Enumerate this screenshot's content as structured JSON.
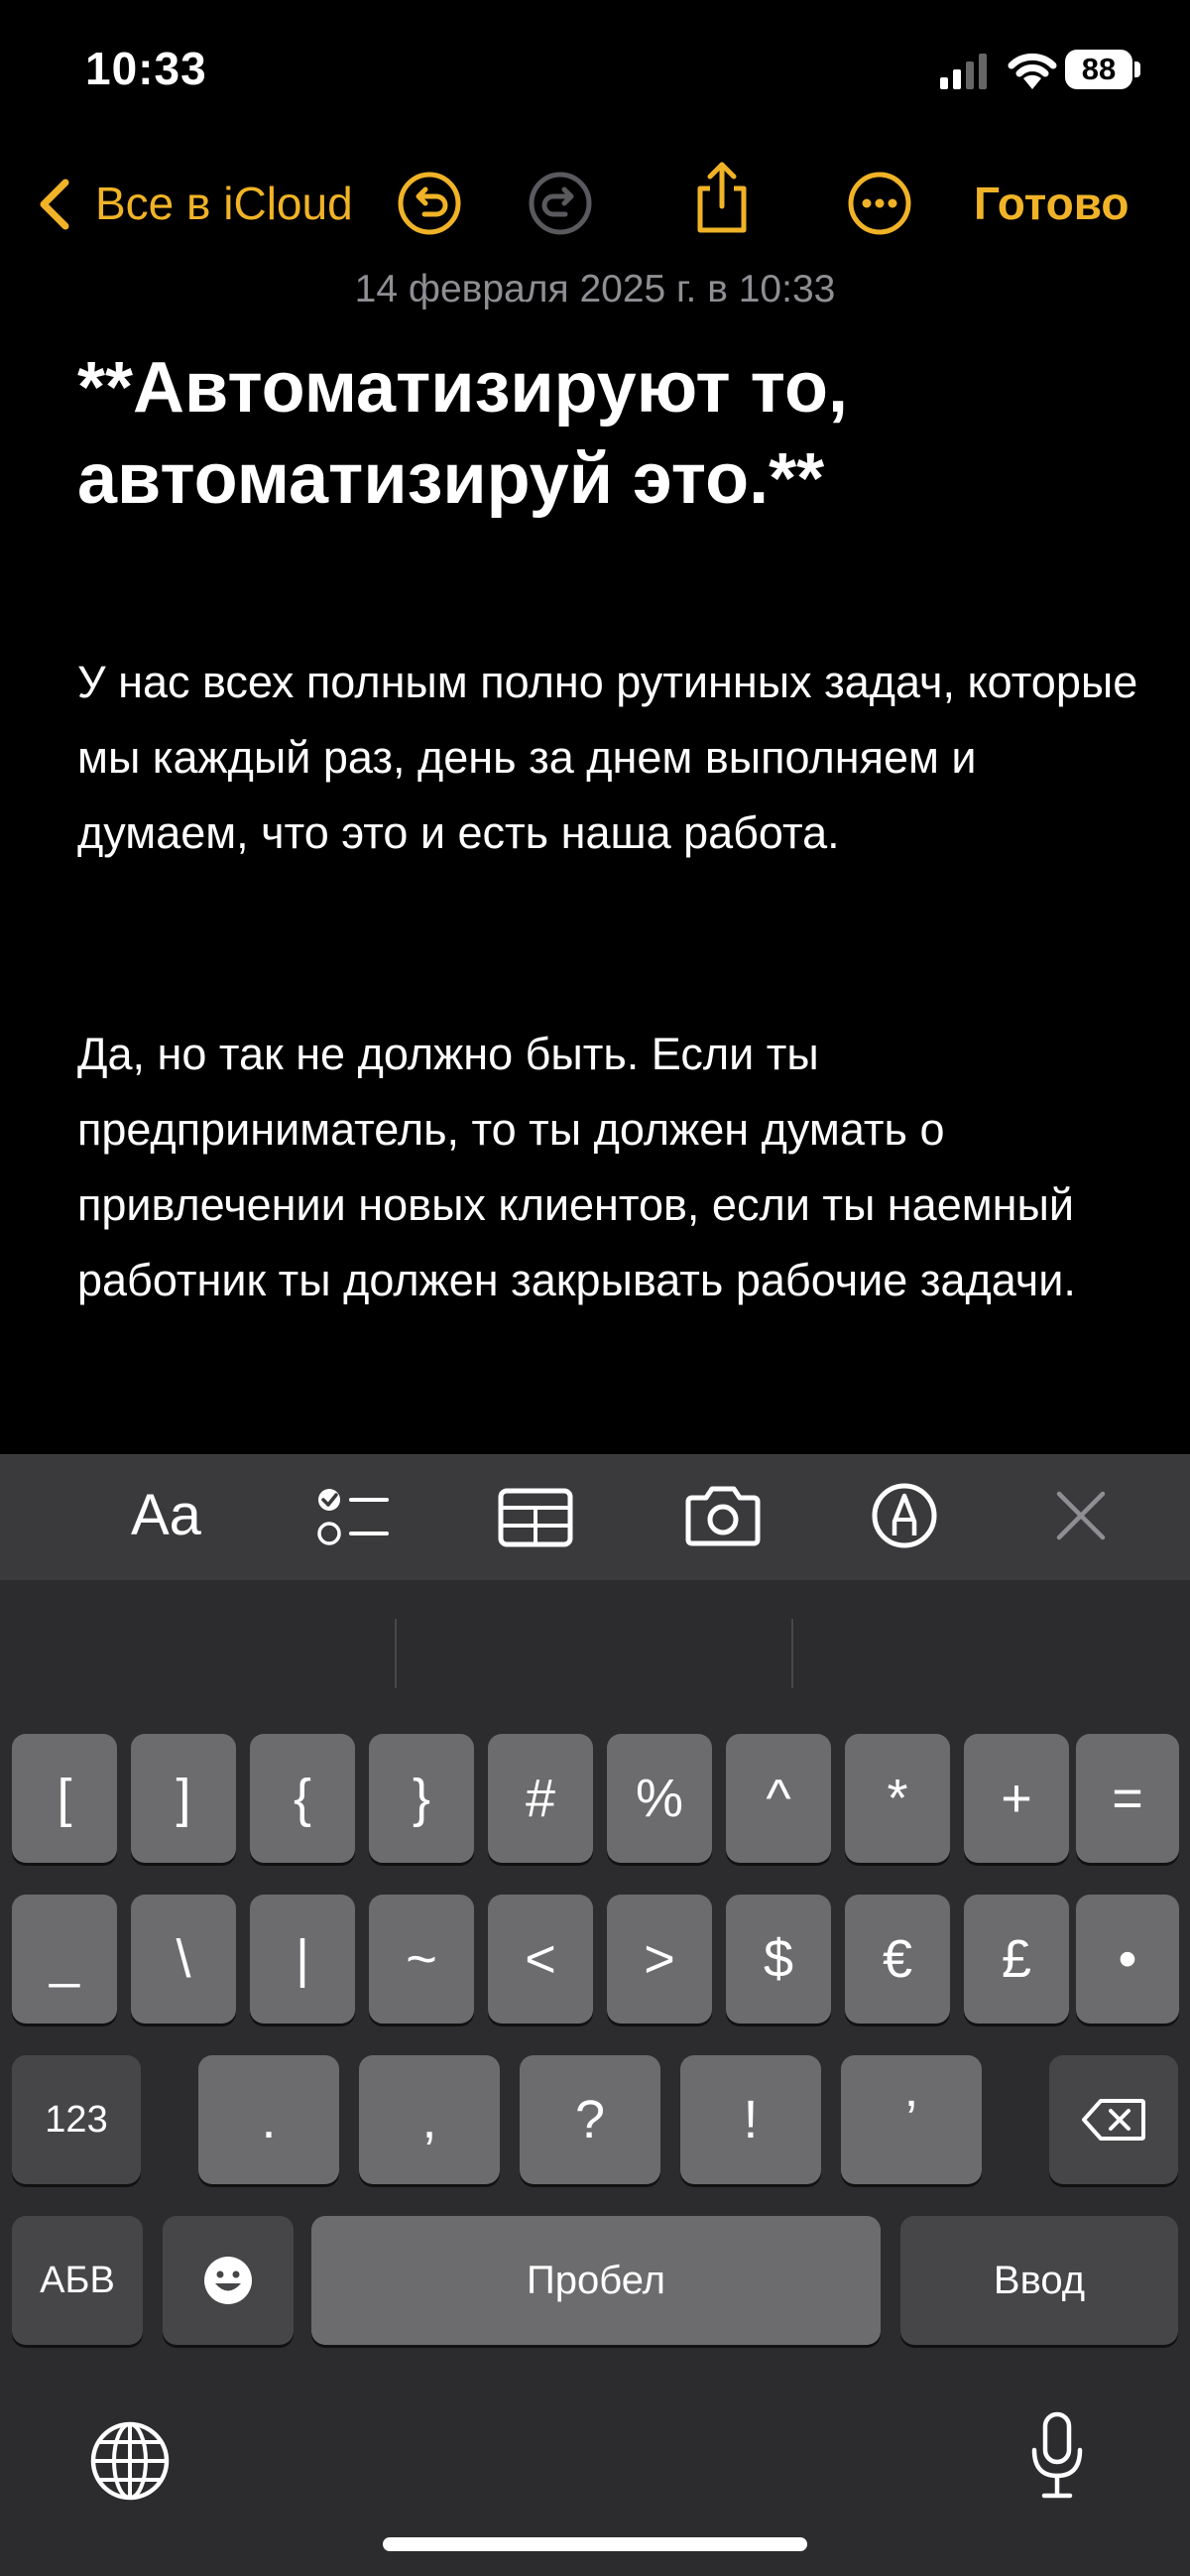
{
  "status_bar": {
    "time": "10:33",
    "battery": "88"
  },
  "nav": {
    "back_label": "Все в iCloud",
    "done_label": "Готово"
  },
  "note": {
    "date": "14 февраля 2025 г. в 10:33",
    "title": "**Автоматизируют то, автоматизируй это.**",
    "paragraphs": [
      "У нас всех полным полно рутинных задач, которые мы каждый раз, день за днем выполняем и думаем, что это и есть наша работа.",
      "Да, но так не должно быть. Если ты предприниматель, то ты должен думать о привлечении новых клиентов, если ты наемный работник ты должен закрывать рабочие задачи."
    ]
  },
  "toolbar": {
    "format_label": "Aa"
  },
  "keyboard": {
    "row1": [
      "[",
      "]",
      "{",
      "}",
      "#",
      "%",
      "^",
      "*",
      "+",
      "="
    ],
    "row2": [
      "_",
      "\\",
      "|",
      "~",
      "<",
      ">",
      "$",
      "€",
      "£",
      "•"
    ],
    "row3": {
      "mode_label": "123",
      "keys": [
        ".",
        ",",
        "?",
        "!",
        "’"
      ]
    },
    "row4": {
      "abc_label": "АБВ",
      "space_label": "Пробел",
      "return_label": "Ввод"
    }
  }
}
